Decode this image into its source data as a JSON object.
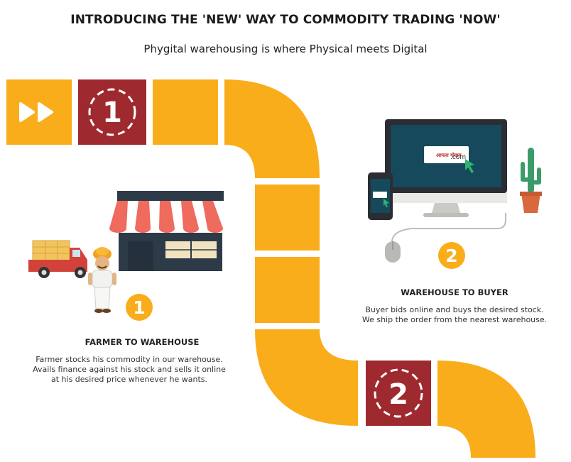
{
  "header": {
    "title": "INTRODUCING THE 'NEW' WAY TO COMMODITY TRADING 'NOW'",
    "subtitle": "Phygital warehousing is where Physical meets Digital"
  },
  "colors": {
    "path": "#f9ad1b",
    "tile_dark": "#9e2a2f",
    "awning_red": "#ee6b5e",
    "store_body": "#2d3a48",
    "screen": "#16495c"
  },
  "steps": [
    {
      "number": "1",
      "title": "FARMER TO WAREHOUSE",
      "description": [
        "Farmer stocks his commodity in our warehouse.",
        "Avails finance against his stock and sells it online",
        "at his desired price whenever he wants."
      ]
    },
    {
      "number": "2",
      "title": "WAREHOUSE TO BUYER",
      "description": [
        "Buyer bids online and buys the desired stock.",
        "We ship the order from the nearest warehouse."
      ]
    }
  ],
  "tiles": {
    "first_number": "1",
    "second_number": "2",
    "start_icon": "fast-forward-icon"
  },
  "website": {
    "logo_text": "आपला गोदाम",
    "domain": ".com"
  }
}
